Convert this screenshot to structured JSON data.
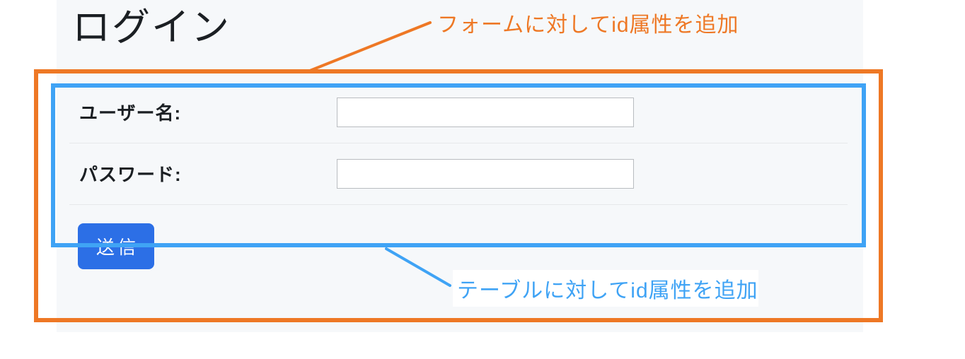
{
  "panel": {
    "title": "ログイン",
    "submit_label": "送信"
  },
  "table": {
    "rows": [
      {
        "label": "ユーザー名:"
      },
      {
        "label": "パスワード:"
      }
    ]
  },
  "annotations": {
    "form": "フォームに対してid属性を追加",
    "table": "テーブルに対してid属性を追加"
  },
  "colors": {
    "orange": "#ee7825",
    "blue": "#3fa3f5",
    "button": "#2c6fe6"
  }
}
